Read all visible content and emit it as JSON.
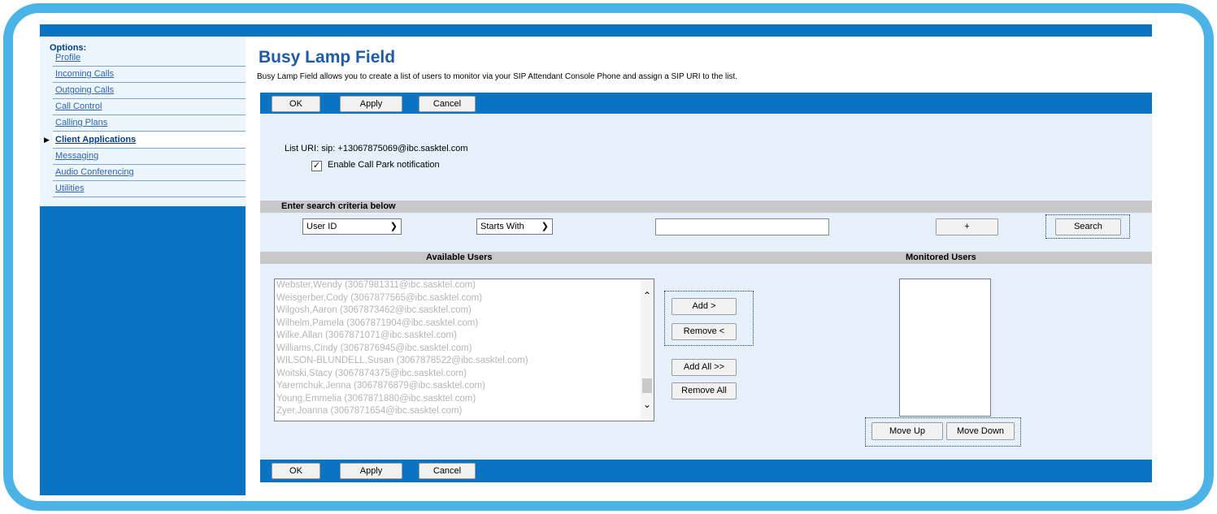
{
  "sidebar": {
    "title": "Options:",
    "items": [
      {
        "label": "Profile"
      },
      {
        "label": "Incoming Calls"
      },
      {
        "label": "Outgoing Calls"
      },
      {
        "label": "Call Control"
      },
      {
        "label": "Calling Plans"
      },
      {
        "label": "Client Applications",
        "active": true
      },
      {
        "label": "Messaging"
      },
      {
        "label": "Audio Conferencing"
      },
      {
        "label": "Utilities"
      }
    ]
  },
  "page": {
    "title": "Busy Lamp Field",
    "description": "Busy Lamp Field allows you to create a list of users to monitor via your SIP Attendant Console Phone and assign a SIP URI to the list."
  },
  "toolbar": {
    "ok": "OK",
    "apply": "Apply",
    "cancel": "Cancel"
  },
  "settings": {
    "list_uri": "List URI: sip: +13067875069@ibc.sasktel.com",
    "call_park_checked": true,
    "call_park_label": "Enable Call Park notification"
  },
  "search": {
    "header": "Enter search criteria below",
    "field_selected": "User ID",
    "mode_selected": "Starts With",
    "value": "",
    "plus_label": "+",
    "search_label": "Search"
  },
  "available": {
    "header": "Available Users",
    "users": [
      "Webster,Wendy (3067981311@ibc.sasktel.com)",
      "Weisgerber,Cody (3067877565@ibc.sasktel.com)",
      "Wilgosh,Aaron (3067873462@ibc.sasktel.com)",
      "Wilhelm,Pamela (3067871904@ibc.sasktel.com)",
      "Wilke,Allan (3067871071@ibc.sasktel.com)",
      "Williams,Cindy (3067876945@ibc.sasktel.com)",
      "WILSON-BLUNDELL,Susan (3067878522@ibc.sasktel.com)",
      "Woitski,Stacy (3067874375@ibc.sasktel.com)",
      "Yaremchuk,Jenna (3067876879@ibc.sasktel.com)",
      "Young,Emmelia (3067871880@ibc.sasktel.com)",
      "Zyer,Joanna (3067871654@ibc.sasktel.com)"
    ]
  },
  "transfer": {
    "add": "Add >",
    "remove": "Remove <",
    "add_all": "Add All >>",
    "remove_all": "Remove All"
  },
  "monitored": {
    "header": "Monitored Users",
    "move_up": "Move Up",
    "move_down": "Move Down"
  },
  "colors": {
    "accent_blue": "#0b74c2",
    "frame": "#4bb3e6",
    "title": "#1f5aa6"
  }
}
